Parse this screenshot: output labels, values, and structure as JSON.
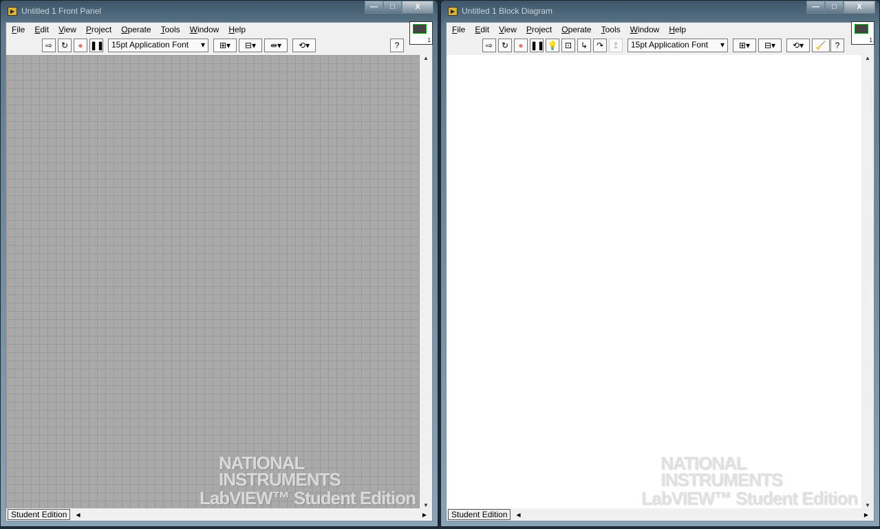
{
  "menu": [
    "File",
    "Edit",
    "View",
    "Project",
    "Operate",
    "Tools",
    "Window",
    "Help"
  ],
  "front_panel": {
    "title": "Untitled 1 Front Panel",
    "font": "15pt Application Font",
    "status": "Student Edition"
  },
  "block_diagram": {
    "title": "Untitled 1 Block Diagram",
    "font": "15pt Application Font",
    "status": "Student Edition"
  },
  "logo": {
    "line1": "NATIONAL",
    "line2": "INSTRUMENTS",
    "line3": "LabVIEW™ Student Edition"
  },
  "vi_icon_number": "1",
  "window_controls": {
    "minimize": "—",
    "maximize": "□",
    "close": "X"
  }
}
